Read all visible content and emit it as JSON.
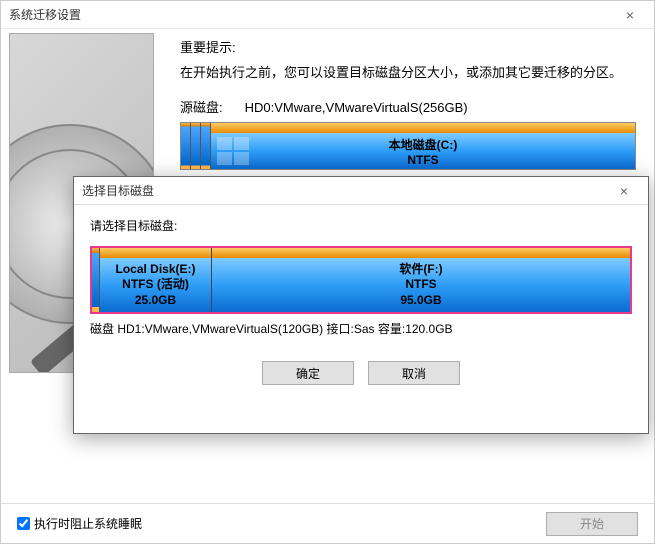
{
  "window": {
    "title": "系统迁移设置",
    "close": "×"
  },
  "hint": {
    "title": "重要提示:",
    "text": "在开始执行之前，您可以设置目标磁盘分区大小，或添加其它要迁移的分区。"
  },
  "source": {
    "label": "源磁盘:",
    "name": "HD0:VMware,VMwareVirtualS(256GB)",
    "partition": {
      "name": "本地磁盘(C:)",
      "fs": "NTFS"
    }
  },
  "modal": {
    "title": "选择目标磁盘",
    "close": "×",
    "prompt": "请选择目标磁盘:",
    "partE": {
      "name": "Local Disk(E:)",
      "fs": "NTFS (活动)",
      "size": "25.0GB"
    },
    "partF": {
      "name": "软件(F:)",
      "fs": "NTFS",
      "size": "95.0GB"
    },
    "info": "磁盘 HD1:VMware,VMwareVirtualS(120GB)  接口:Sas  容量:120.0GB",
    "ok": "确定",
    "cancel": "取消"
  },
  "footer": {
    "checkbox": "执行时阻止系统睡眠",
    "start": "开始"
  }
}
